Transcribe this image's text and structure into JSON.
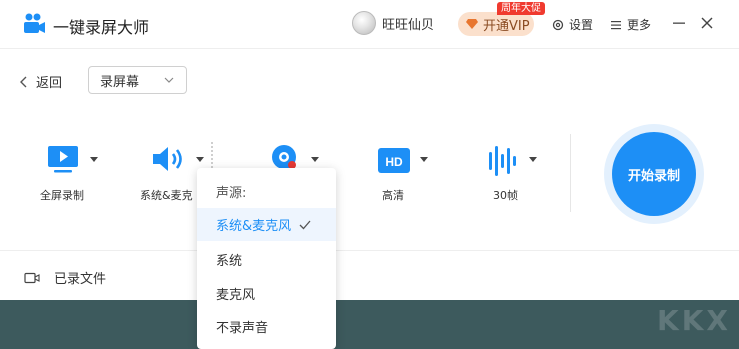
{
  "app": {
    "title": "一键录屏大师"
  },
  "user": {
    "name": "旺旺仙贝"
  },
  "vip": {
    "label": "开通VIP",
    "promo": "周年大促"
  },
  "header": {
    "settings": "设置",
    "more": "更多"
  },
  "nav": {
    "back": "返回",
    "mode": "录屏幕"
  },
  "tools": {
    "fullscreen": "全屏录制",
    "audio": "系统&麦克",
    "quality": "高清",
    "fps": "30帧"
  },
  "start": {
    "label": "开始录制"
  },
  "files": {
    "label": "已录文件"
  },
  "audio_menu": {
    "header": "声源:",
    "items": [
      {
        "label": "系统&麦克风",
        "selected": true
      },
      {
        "label": "系统",
        "selected": false
      },
      {
        "label": "麦克风",
        "selected": false
      },
      {
        "label": "不录声音",
        "selected": false
      }
    ]
  },
  "colors": {
    "accent": "#1d8ff6",
    "bottom": "#3d5a5d",
    "vip_bg": "#fbe0cc",
    "promo": "#f03a2f"
  }
}
